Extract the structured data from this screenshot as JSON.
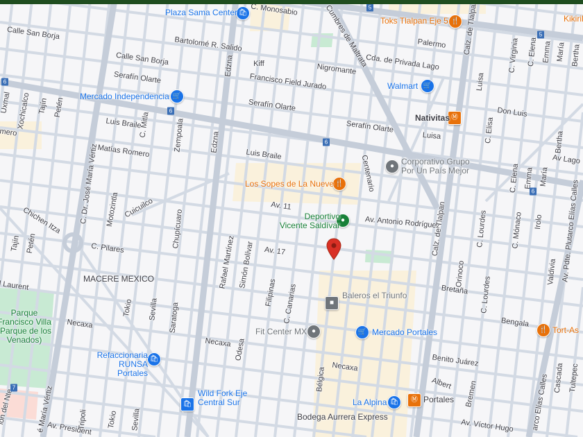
{
  "map": {
    "streets": [
      "C. Monosabio",
      "Calle San Borja",
      "Bartolomé R. Salido",
      "Calle San Borja",
      "Kiff",
      "Francisco Field Jurado",
      "Serafín Olarte",
      "Serafín Olarte",
      "Nigromante",
      "Cda. de Privada Lago",
      "Palermo",
      "Serafín Olarte",
      "Luisa",
      "Don Luis",
      "Av Lago",
      "Luis Braile",
      "Matías Romero",
      "Luis Braile",
      "mero",
      "Av. 11",
      "Av. Antonio Rodríguez",
      "C. Pilares",
      "Av. 17",
      "l Laurent",
      "Necaxa",
      "Necaxa",
      "Necaxa",
      "Bretaña",
      "Bengala",
      "Benito Juárez",
      "Albert",
      "Av. Víctor Hugo",
      "Av. President",
      "Uxmal",
      "Xochicalco",
      "Tajín",
      "Petén",
      "C. Dr. José María Vértiz",
      "C. Mitla",
      "Zempoala",
      "Edzna",
      "Edzna",
      "Motozintla",
      "Cuicuilco",
      "Chichen Itza",
      "Chupícuaro",
      "Rafael Martínez",
      "Simón Bolívar",
      "Filipinas",
      "C. Canarias",
      "Odesa",
      "Tokio",
      "Sevilla",
      "Saratoga",
      "Tokio",
      "Sevilla",
      "Tripoli",
      "Bélgica",
      "Centenario",
      "Cumbres de Maltrata",
      "Calz. de Tlalpan",
      "Calz. de Tlalpan",
      "Luisa",
      "C. Virginia",
      "C. Elena",
      "Emma",
      "María",
      "Bertha",
      "C. Elisa",
      "C. Elena",
      "Emma",
      "María",
      "Bertha",
      "C. Lourdes",
      "C. Lourdes",
      "C. Mónaco",
      "Irolo",
      "Orinoco",
      "Valdivia",
      "Av. Pdte. Plutarco Elías Calles",
      "Bremen",
      "Cascada",
      "Tultepec",
      "arco Elías Calles",
      "ión del Nte.",
      "é María Vértiz",
      "Tajín",
      "Petén"
    ],
    "pois": [
      {
        "name": "Plaza Sama Center",
        "icon": "shopping-bag-icon",
        "color": "#1a73e8"
      },
      {
        "name": "Toks Tlalpan Eje 5",
        "icon": "restaurant-icon",
        "color": "#e8710a"
      },
      {
        "name": "KikiriKi",
        "icon": "",
        "color": "#e8710a"
      },
      {
        "name": "Mercado Independencia",
        "icon": "shopping-cart-icon",
        "color": "#1a73e8"
      },
      {
        "name": "Walmart",
        "icon": "shopping-cart-icon",
        "color": "#1a73e8"
      },
      {
        "name": "Nativitas",
        "icon": "metro-icon",
        "color": "#e8710a"
      },
      {
        "name": "Corporativo Grupo Por Un País Mejor",
        "icon": "place-icon",
        "color": "#70757a"
      },
      {
        "name": "Los Sopes de La Nueve",
        "icon": "restaurant-icon",
        "color": "#e8710a"
      },
      {
        "name": "Deportivo Vicente Saldívar",
        "icon": "park-icon",
        "color": "#188038"
      },
      {
        "name": "MACERE MEXICO",
        "icon": "",
        "color": "#3c3c44"
      },
      {
        "name": "Parque Francisco Villa (Parque de los Venados)",
        "icon": "",
        "color": "#188038"
      },
      {
        "name": "Baleros el Triunfo",
        "icon": "store-icon",
        "color": "#70757a"
      },
      {
        "name": "Fit Center MX",
        "icon": "place-icon",
        "color": "#70757a"
      },
      {
        "name": "Mercado Portales",
        "icon": "shopping-cart-icon",
        "color": "#1a73e8"
      },
      {
        "name": "Tort-As",
        "icon": "restaurant-icon",
        "color": "#e8710a"
      },
      {
        "name": "Refaccionaria RUNSA Portales",
        "icon": "shopping-bag-icon",
        "color": "#1a73e8"
      },
      {
        "name": "Wild Fork Eje Central Sur",
        "icon": "shopping-bag-icon",
        "color": "#1a73e8"
      },
      {
        "name": "La Alpina",
        "icon": "shopping-bag-icon",
        "color": "#1a73e8"
      },
      {
        "name": "Portales",
        "icon": "metro-icon",
        "color": "#e8710a"
      },
      {
        "name": "Bodega Aurrera Express",
        "icon": "",
        "color": "#3c3c44"
      }
    ],
    "route_shields": [
      "6",
      "6",
      "6",
      "6",
      "5",
      "5",
      "7"
    ],
    "colors": {
      "road": "#d0d8e2",
      "major_road": "#c3ccd8",
      "commercial": "#faf1dc",
      "park": "#c8ead3",
      "pin": "#d93025"
    }
  }
}
